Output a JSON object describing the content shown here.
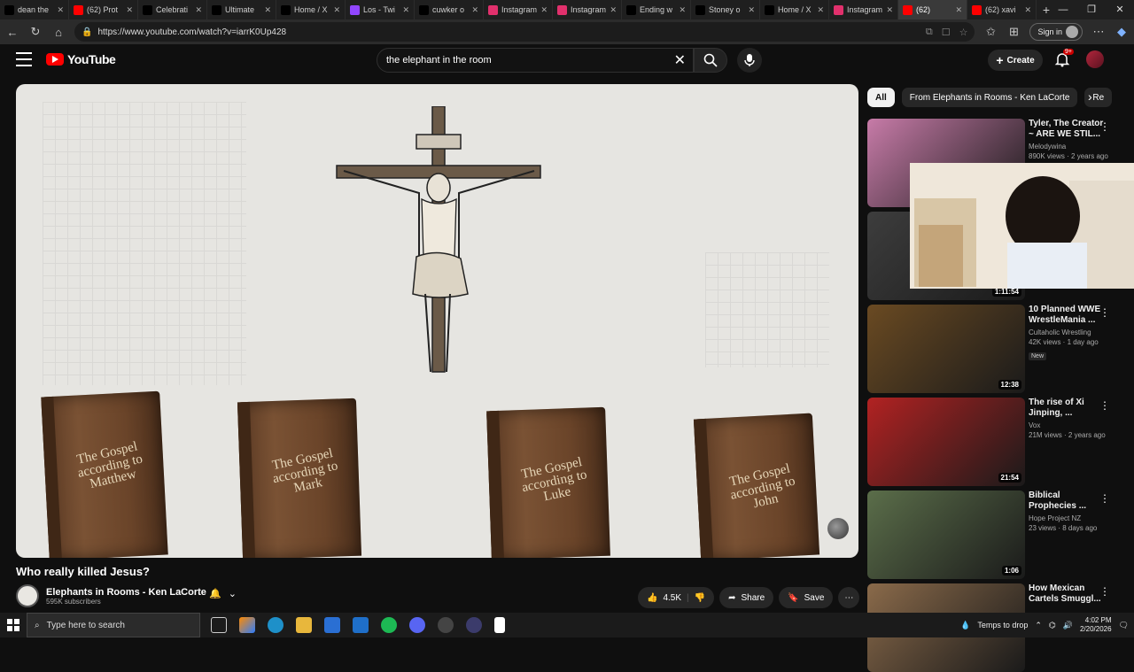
{
  "browser": {
    "tabs": [
      {
        "label": "dean the",
        "icon": "x-icon",
        "color": "#000000"
      },
      {
        "label": "(62) Prot",
        "icon": "youtube-icon",
        "color": "#ff0000"
      },
      {
        "label": "Celebrati",
        "icon": "tiktok-icon",
        "color": "#000000"
      },
      {
        "label": "Ultimate",
        "icon": "tiktok-icon",
        "color": "#000000"
      },
      {
        "label": "Home / X",
        "icon": "x-icon",
        "color": "#000000"
      },
      {
        "label": "Los - Twi",
        "icon": "twitch-icon",
        "color": "#9146ff"
      },
      {
        "label": "cuwker o",
        "icon": "x-icon",
        "color": "#000000"
      },
      {
        "label": "Instagram",
        "icon": "instagram-icon",
        "color": "#e1306c"
      },
      {
        "label": "Instagram",
        "icon": "instagram-icon",
        "color": "#e1306c"
      },
      {
        "label": "Ending w",
        "icon": "tiktok-icon",
        "color": "#000000"
      },
      {
        "label": "Stoney o",
        "icon": "x-icon",
        "color": "#000000"
      },
      {
        "label": "Home / X",
        "icon": "x-icon",
        "color": "#000000"
      },
      {
        "label": "Instagram",
        "icon": "instagram-icon",
        "color": "#e1306c"
      },
      {
        "label": "(62)",
        "icon": "youtube-icon",
        "color": "#ff0000",
        "active": true
      },
      {
        "label": "(62) xavi",
        "icon": "youtube-icon",
        "color": "#ff0000"
      }
    ],
    "url": "https://www.youtube.com/watch?v=iarrK0Up428",
    "signin_label": "Sign in"
  },
  "youtube": {
    "logo_text": "YouTube",
    "search_value": "the elephant in the room",
    "create_label": "Create",
    "notif_badge": "9+"
  },
  "video": {
    "title": "Who really killed Jesus?",
    "channel": "Elephants in Rooms - Ken LaCorte",
    "subscribers": "595K subscribers",
    "likes": "4.5K",
    "share_label": "Share",
    "save_label": "Save",
    "books": [
      {
        "title": "The Gospel according to Matthew"
      },
      {
        "title": "The Gospel according to Mark"
      },
      {
        "title": "The Gospel according to Luke"
      },
      {
        "title": "The Gospel according to John"
      }
    ]
  },
  "chips": {
    "all": "All",
    "from_channel": "From Elephants in Rooms - Ken LaCorte",
    "related": "Re"
  },
  "recommendations": [
    {
      "title": "Tyler, The Creator ~ ARE WE STIL...",
      "channel": "Melodywina",
      "views": "890K views · 2 years ago",
      "duration": "",
      "thumb_color": "#c77ba8"
    },
    {
      "title": "",
      "channel": "",
      "views": "",
      "duration": "1:11:54",
      "thumb_color": "#3d3d3d"
    },
    {
      "title": "10 Planned WWE WrestleMania ...",
      "channel": "Cultaholic Wrestling",
      "views": "42K views · 1 day ago",
      "badge": "New",
      "duration": "12:38",
      "thumb_color": "#6a4a22"
    },
    {
      "title": "The rise of Xi Jinping, ...",
      "channel": "Vox",
      "views": "21M views · 2 years ago",
      "duration": "21:54",
      "thumb_color": "#b22222"
    },
    {
      "title": "Biblical Prophecies ...",
      "channel": "Hope Project NZ",
      "views": "23 views · 8 days ago",
      "duration": "1:06",
      "thumb_color": "#5b6e4a"
    },
    {
      "title": "How Mexican Cartels Smuggl...",
      "channel": "",
      "views": "",
      "duration": "",
      "thumb_color": "#8a6a4a"
    }
  ],
  "taskbar": {
    "search_placeholder": "Type here to search",
    "weather": "Temps to drop",
    "time": "4:02 PM",
    "date": "2/20/2026"
  }
}
